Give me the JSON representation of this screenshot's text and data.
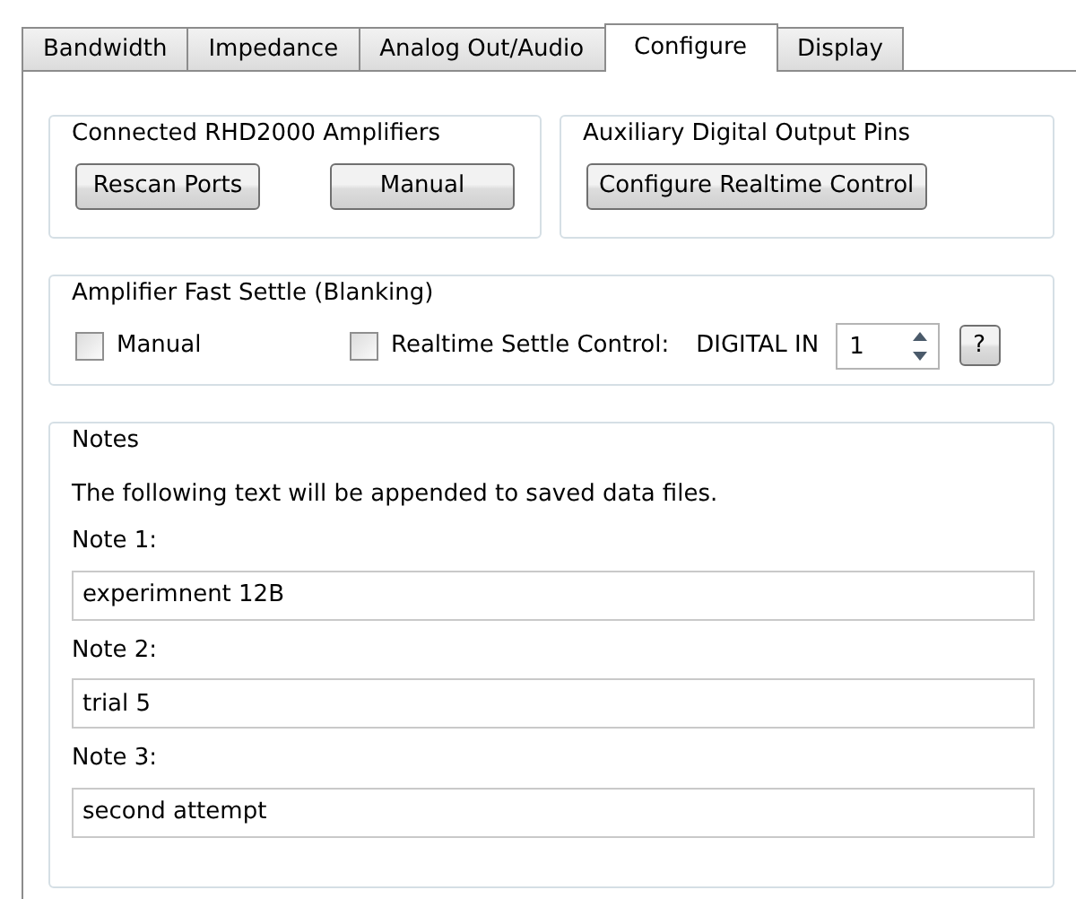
{
  "tabs": [
    {
      "label": "Bandwidth",
      "selected": false
    },
    {
      "label": "Impedance",
      "selected": false
    },
    {
      "label": "Analog Out/Audio",
      "selected": false
    },
    {
      "label": "Configure",
      "selected": true
    },
    {
      "label": "Display",
      "selected": false
    }
  ],
  "amplifiers": {
    "title": "Connected RHD2000 Amplifiers",
    "buttons": [
      "Rescan Ports",
      "Manual"
    ]
  },
  "aux_pins": {
    "title": "Auxiliary Digital Output Pins",
    "buttons": [
      "Configure Realtime Control"
    ]
  },
  "fast_settle": {
    "title": "Amplifier Fast Settle (Blanking)",
    "manual": {
      "label": "Manual",
      "checked": false
    },
    "realtime": {
      "label": "Realtime Settle Control:",
      "checked": false
    },
    "digital_in_label": "DIGITAL IN",
    "digital_in_value": "1",
    "help_button": "?"
  },
  "notes": {
    "title": "Notes",
    "description": "The following text will be appended to saved data files.",
    "fields": [
      {
        "label": "Note 1:",
        "value": "experimnent 12B"
      },
      {
        "label": "Note 2:",
        "value": "trial 5"
      },
      {
        "label": "Note 3:",
        "value": "second attempt"
      }
    ]
  }
}
